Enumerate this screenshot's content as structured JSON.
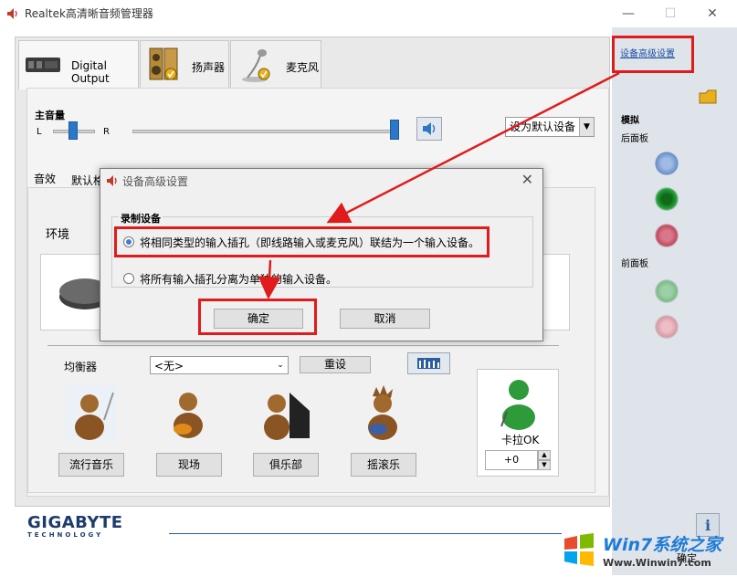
{
  "window": {
    "title": "Realtek高清晰音频管理器",
    "minimize": "—",
    "maximize": "☐",
    "close": "✕"
  },
  "tabs": [
    {
      "label": "Digital Output",
      "icon": "digital-output-device-icon"
    },
    {
      "label": "扬声器",
      "icon": "speaker-icon"
    },
    {
      "label": "麦克风",
      "icon": "microphone-icon"
    }
  ],
  "volume": {
    "label": "主音量",
    "left": "L",
    "right": "R",
    "default_device_select": "设为默认设备"
  },
  "sub_tabs": [
    "音效",
    "默认格"
  ],
  "environment_label": "环境",
  "equalizer": {
    "label": "均衡器",
    "preset": "<无>",
    "reset": "重设"
  },
  "presets": [
    "流行音乐",
    "现场",
    "俱乐部",
    "摇滚乐"
  ],
  "karaoke": {
    "label": "卡拉OK",
    "value": "+0"
  },
  "right_panel": {
    "link": "设备高级设置",
    "analog": "模拟",
    "back_panel": "后面板",
    "front_panel": "前面板",
    "jack_colors_back": [
      "#7a9bd0",
      "#1e9a2e",
      "#d95e6e"
    ],
    "jack_colors_front": [
      "#8cc89a",
      "#e2a7b0"
    ]
  },
  "footer": {
    "brand": "GIGABYTE",
    "brand_sub": "TECHNOLOGY",
    "ok": "确定"
  },
  "dialog": {
    "title": "设备高级设置",
    "group_label": "录制设备",
    "option1": "将相同类型的输入插孔（即线路输入或麦克风）联结为一个输入设备。",
    "option2": "将所有输入插孔分离为单独的输入设备。",
    "ok": "确定",
    "cancel": "取消"
  },
  "watermark": {
    "line1": "Win7系统之家",
    "line2": "Www.Winwin7.com"
  }
}
